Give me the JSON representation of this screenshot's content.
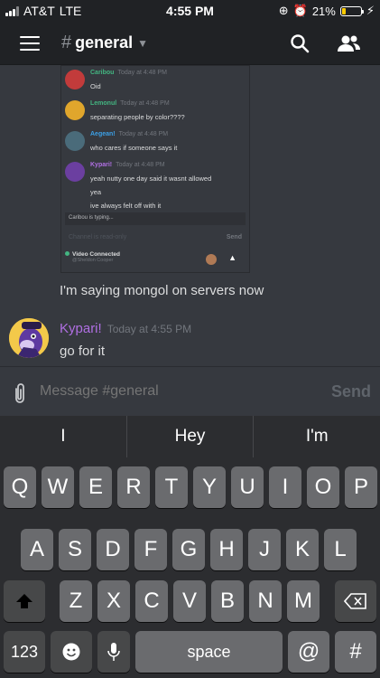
{
  "status_bar": {
    "carrier": "AT&T",
    "network": "LTE",
    "time": "4:55 PM",
    "battery_percent": "21%",
    "battery_level": 0.21
  },
  "header": {
    "channel_hash": "#",
    "channel_name": "general",
    "icons": [
      "menu-icon",
      "search-icon",
      "members-icon"
    ]
  },
  "embedded_screenshot": {
    "messages": [
      {
        "author": "Caribou",
        "time": "Today at 4:48 PM",
        "text": "Oid",
        "color": "#43b581"
      },
      {
        "author": "Lemonul",
        "time": "Today at 4:48 PM",
        "text": "separating people by color????",
        "color": "#43b581"
      },
      {
        "author": "Aegean!",
        "time": "Today at 4:48 PM",
        "text": "who cares if someone says it",
        "color": "#3ca0e6"
      },
      {
        "author": "Kypari!",
        "time": "Today at 4:48 PM",
        "text": "yeah nutty one day said it wasnt allowed",
        "color": "#b06fe3"
      }
    ],
    "extra_lines": [
      "yea",
      "ive always felt off with it"
    ],
    "typing": "Caribou is typing...",
    "input_placeholder": "Channel is read-only",
    "input_send": "Send",
    "video_status": "Video Connected",
    "video_sub": "@Sheldon Cooper"
  },
  "messages": {
    "plain_text": "I'm saying mongol on servers now",
    "author": "Kypari!",
    "author_color": "#b06fe3",
    "time": "Today at 4:55 PM",
    "body": "go for it"
  },
  "composer": {
    "placeholder": "Message #general",
    "send_label": "Send"
  },
  "keyboard": {
    "suggestions": [
      "I",
      "Hey",
      "I'm"
    ],
    "row1": [
      "Q",
      "W",
      "E",
      "R",
      "T",
      "Y",
      "U",
      "I",
      "O",
      "P"
    ],
    "row2": [
      "A",
      "S",
      "D",
      "F",
      "G",
      "H",
      "J",
      "K",
      "L"
    ],
    "row3": [
      "Z",
      "X",
      "C",
      "V",
      "B",
      "N",
      "M"
    ],
    "numbers_label": "123",
    "space_label": "space",
    "at_label": "@",
    "hash_label": "#"
  }
}
